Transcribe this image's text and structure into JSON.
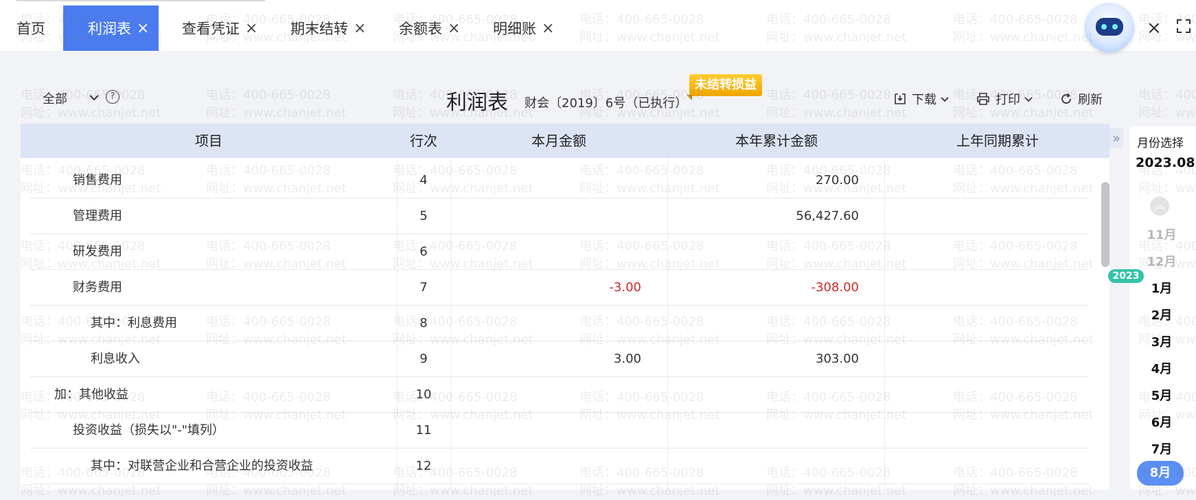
{
  "tabs": [
    {
      "label": "首页",
      "closable": false,
      "active": false
    },
    {
      "label": "利润表",
      "closable": true,
      "active": true
    },
    {
      "label": "查看凭证",
      "closable": true,
      "active": false
    },
    {
      "label": "期末结转",
      "closable": true,
      "active": false
    },
    {
      "label": "余额表",
      "closable": true,
      "active": false
    },
    {
      "label": "明细账",
      "closable": true,
      "active": false
    }
  ],
  "close_glyph": "×",
  "toolbar": {
    "scope": "全部",
    "help": "?",
    "title": "利润表",
    "subtitle": "财会〔2019〕6号（已执行）",
    "badge": "未结转损益",
    "download": "下载",
    "print": "打印",
    "refresh": "刷新"
  },
  "table": {
    "headers": [
      "项目",
      "行次",
      "本月金额",
      "本年累计金额",
      "上年同期累计"
    ],
    "rows": [
      {
        "item": "销售费用",
        "line": "4",
        "month": "",
        "ytd": "270.00",
        "prior": ""
      },
      {
        "item": "管理费用",
        "line": "5",
        "month": "",
        "ytd": "56,427.60",
        "prior": ""
      },
      {
        "item": "研发费用",
        "line": "6",
        "month": "",
        "ytd": "",
        "prior": ""
      },
      {
        "item": "财务费用",
        "line": "7",
        "month": "-3.00",
        "ytd": "-308.00",
        "prior": ""
      },
      {
        "item": "其中：利息费用",
        "line": "8",
        "month": "",
        "ytd": "",
        "prior": ""
      },
      {
        "item": "利息收入",
        "line": "9",
        "month": "3.00",
        "ytd": "303.00",
        "prior": ""
      },
      {
        "item": "加：其他收益",
        "line": "10",
        "month": "",
        "ytd": "",
        "prior": ""
      },
      {
        "item": "投资收益（损失以\"-\"填列）",
        "line": "11",
        "month": "",
        "ytd": "",
        "prior": ""
      },
      {
        "item": "其中：对联营企业和合营企业的投资收益",
        "line": "12",
        "month": "",
        "ytd": "",
        "prior": ""
      }
    ]
  },
  "month_panel": {
    "title": "月份选择",
    "current": "2023.08",
    "year_badge": "2023",
    "months": [
      {
        "label": "11月",
        "state": "faded"
      },
      {
        "label": "12月",
        "state": "faded"
      },
      {
        "label": "1月",
        "state": "normal"
      },
      {
        "label": "2月",
        "state": "normal"
      },
      {
        "label": "3月",
        "state": "normal"
      },
      {
        "label": "4月",
        "state": "normal"
      },
      {
        "label": "5月",
        "state": "normal"
      },
      {
        "label": "6月",
        "state": "normal"
      },
      {
        "label": "7月",
        "state": "normal"
      },
      {
        "label": "8月",
        "state": "selected"
      }
    ]
  },
  "watermark": {
    "phone": "电话：400-665-0028",
    "site": "网址：www.chanjet.net"
  },
  "colors": {
    "accent": "#4a7cf0",
    "negative": "#d42a2a",
    "badge": "#f0a500",
    "year_badge": "#34c3a7"
  }
}
